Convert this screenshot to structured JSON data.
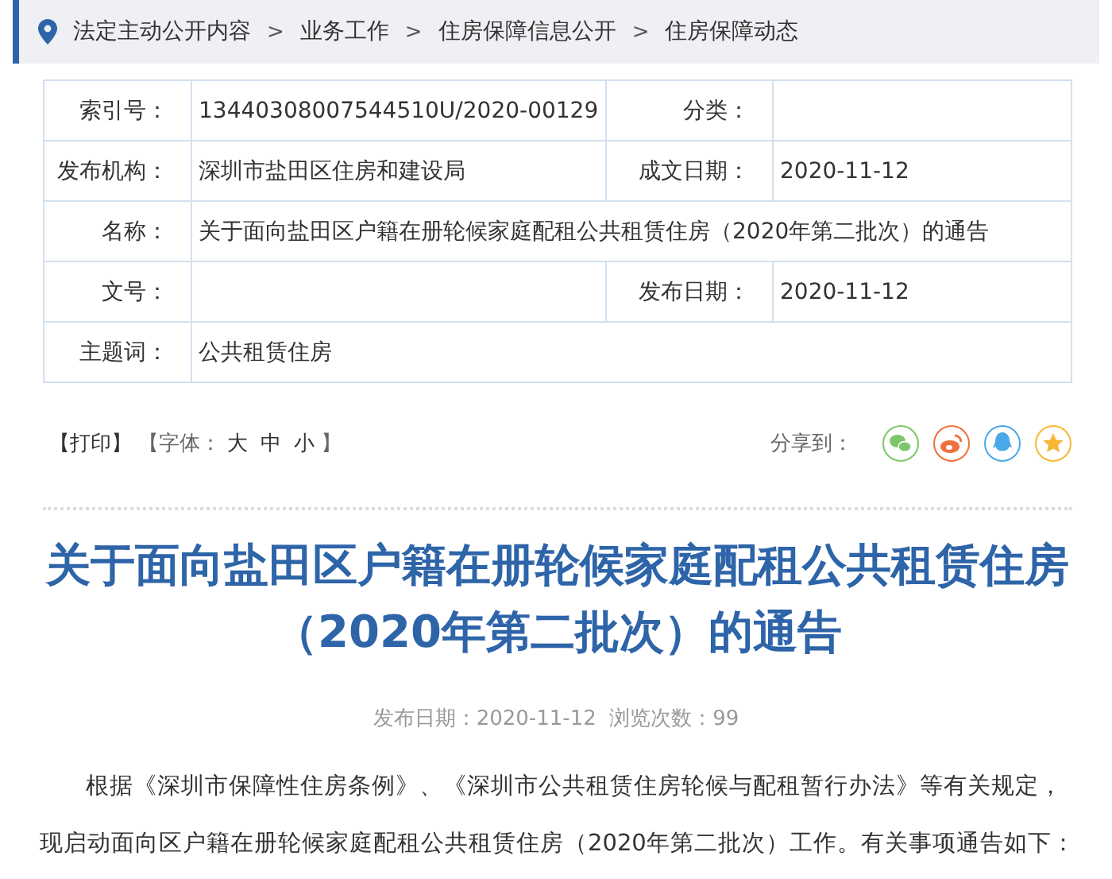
{
  "breadcrumb": {
    "items": [
      "法定主动公开内容",
      "业务工作",
      "住房保障信息公开",
      "住房保障动态"
    ],
    "separator": ">"
  },
  "info_table": {
    "rows": [
      {
        "cells": [
          {
            "label": "索引号：",
            "value": "13440308007544510U/2020-00129"
          },
          {
            "label": "分类："
          }
        ]
      },
      {
        "cells": [
          {
            "label": "发布机构：",
            "value": "深圳市盐田区住房和建设局"
          },
          {
            "label": "成文日期：",
            "value": "2020-11-12"
          }
        ]
      },
      {
        "cells": [
          {
            "label": "名称：",
            "value": "关于面向盐田区户籍在册轮候家庭配租公共租赁住房（2020年第二批次）的通告"
          }
        ]
      },
      {
        "cells": [
          {
            "label": "文号："
          },
          {
            "label": "发布日期：",
            "value": "2020-11-12"
          }
        ]
      },
      {
        "cells": [
          {
            "label": "主题词：",
            "value": "公共租赁住房"
          }
        ]
      }
    ]
  },
  "tools": {
    "print": "【打印】",
    "font_label": "【字体：",
    "sizes": [
      "大",
      "中",
      "小"
    ],
    "close": "】"
  },
  "share": {
    "label": "分享到：",
    "targets": [
      {
        "kind": "chat",
        "color": "#7cc76a"
      },
      {
        "kind": "swirl",
        "color": "#f0703e"
      },
      {
        "kind": "penguin",
        "color": "#4aa8e8"
      },
      {
        "kind": "star",
        "color": "#f7b733"
      }
    ]
  },
  "article": {
    "title": "关于面向盐田区户籍在册轮候家庭配租公共租赁住房（2020年第二批次）的通告",
    "meta": "发布日期：2020-11-12  浏览次数：99",
    "paragraphs": [
      "根据《深圳市保障性住房条例》、《深圳市公共租赁住房轮候与配租暂行办法》等有关规定，现启动面向区户籍在册轮候家庭配租公共租赁住房（2020年第二批次）工作。有关事项通告如下："
    ]
  }
}
